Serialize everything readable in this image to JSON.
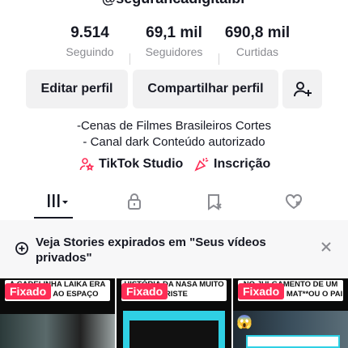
{
  "profile": {
    "handle": "@segurancadigitalbr"
  },
  "stats": [
    {
      "value": "9.514",
      "label": "Seguindo"
    },
    {
      "value": "69,1 mil",
      "label": "Seguidores"
    },
    {
      "value": "690,8 mil",
      "label": "Curtidas"
    }
  ],
  "actions": {
    "edit_label": "Editar perfil",
    "share_label": "Compartilhar perfil",
    "add_friend_icon": "add-person-icon"
  },
  "bio": {
    "line1": "-Cenas de Filmes Brasileiros Cortes",
    "line2": "- Canal dark Conteúdo autorizado"
  },
  "links": {
    "studio_label": "TikTok Studio",
    "signup_label": "Inscrição"
  },
  "tabs": [
    {
      "icon": "grid-icon",
      "active": true
    },
    {
      "icon": "lock-icon",
      "active": false
    },
    {
      "icon": "bookmark-icon",
      "active": false
    },
    {
      "icon": "liked-heart-icon",
      "active": false
    }
  ],
  "banner": {
    "text": "Veja Stories expirados em \"Seus vídeos privados\""
  },
  "videos": [
    {
      "pin_label": "Fixado",
      "caption": "A CADELINHA LAIKA ERA ENVIADA AO ESPAÇO"
    },
    {
      "pin_label": "Fixado",
      "caption": "HISTÓRIA DA NASA MUITO TRISTE"
    },
    {
      "pin_label": "Fixado",
      "caption": "NO JULGAMENTO DE UM JOVEM QUE MAT**OU O PAI"
    }
  ],
  "colors": {
    "accent": "#fe2c55",
    "text": "#161823",
    "muted": "#8a8b91",
    "button_bg": "#f1f1f2"
  }
}
